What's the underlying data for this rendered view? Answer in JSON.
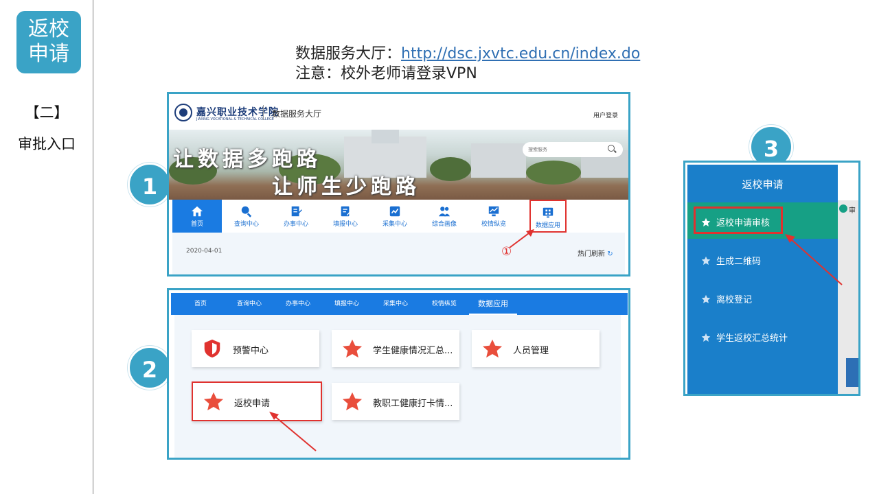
{
  "section": {
    "badge_line1": "返校",
    "badge_line2": "申请",
    "part": "【二】",
    "part_title": "审批入口"
  },
  "header": {
    "line1_label": "数据服务大厅：",
    "line1_link": "http://dsc.jxvtc.edu.cn/index.do",
    "line2": "注意：校外老师请登录VPN"
  },
  "steps": [
    "1",
    "2",
    "3"
  ],
  "panel1": {
    "school_name": "嘉兴职业技术学院",
    "school_name_en": "JIAXING VOCATIONAL & TECHNICAL COLLEGE",
    "portal_name": "数据服务大厅",
    "user_login": "用户登录",
    "slogan_line1": "让数据多跑路",
    "slogan_line2": "让师生少跑路",
    "search_placeholder": "搜索服务",
    "nav": [
      {
        "label": "首页",
        "icon": "home-icon"
      },
      {
        "label": "查询中心",
        "icon": "search-icon"
      },
      {
        "label": "办事中心",
        "icon": "edit-doc-icon"
      },
      {
        "label": "填报中心",
        "icon": "form-icon"
      },
      {
        "label": "采集中心",
        "icon": "collect-icon"
      },
      {
        "label": "综合画像",
        "icon": "people-icon"
      },
      {
        "label": "校情纵览",
        "icon": "trend-chart-icon"
      },
      {
        "label": "数据应用",
        "icon": "data-app-icon"
      }
    ],
    "date": "2020-04-01",
    "hot_refresh": "热门刷新",
    "annotation": "①"
  },
  "panel2": {
    "nav": [
      "首页",
      "查询中心",
      "办事中心",
      "填报中心",
      "采集中心",
      "校情纵览",
      "数据应用"
    ],
    "cards": [
      {
        "label": "预警中心",
        "icon": "shield-icon"
      },
      {
        "label": "学生健康情况汇总...",
        "icon": "star-icon"
      },
      {
        "label": "人员管理",
        "icon": "star-icon"
      },
      {
        "label": "返校申请",
        "icon": "star-icon"
      },
      {
        "label": "教职工健康打卡情...",
        "icon": "star-icon"
      }
    ]
  },
  "panel3": {
    "title": "返校申请",
    "items": [
      "返校申请审核",
      "生成二维码",
      "离校登记",
      "学生返校汇总统计"
    ],
    "right_text": "审"
  },
  "colors": {
    "accent": "#3aa3c6",
    "nav_blue": "#1a7be2",
    "highlight_red": "#e0322f",
    "active_green": "#16a085"
  }
}
